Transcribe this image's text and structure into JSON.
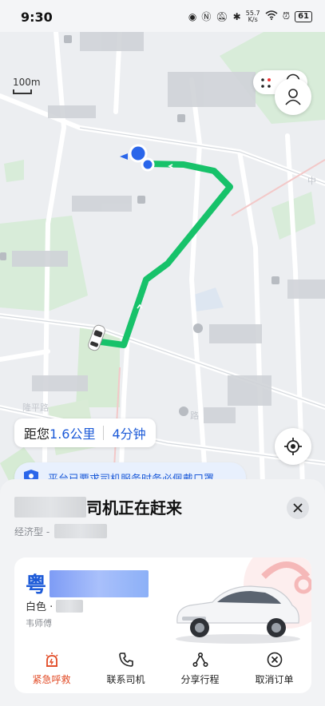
{
  "status_bar": {
    "time": "9:30",
    "net_speed": "55.7",
    "net_unit": "K/s",
    "battery": "61"
  },
  "map": {
    "scale_label": "100m",
    "road_label_1": "中",
    "road_label_2": "路",
    "road_label_3": "隆平路"
  },
  "eta": {
    "prefix": "距您",
    "distance": "1.6公里",
    "time": "4分钟"
  },
  "notice": {
    "text": "平台已要求司机服务时务必佩戴口罩"
  },
  "sheet": {
    "title_suffix": "司机正在赶来",
    "car_type": "经济型 -"
  },
  "driver": {
    "plate_prefix": "粤",
    "color": "白色 ·",
    "name": "韦师傅"
  },
  "actions": [
    {
      "label": "紧急呼救",
      "icon": "sos-icon"
    },
    {
      "label": "联系司机",
      "icon": "phone-icon"
    },
    {
      "label": "分享行程",
      "icon": "share-icon"
    },
    {
      "label": "取消订单",
      "icon": "cancel-icon"
    }
  ],
  "colors": {
    "route": "#17c26a",
    "accent": "#1d5bd8",
    "sos": "#e24b26"
  }
}
